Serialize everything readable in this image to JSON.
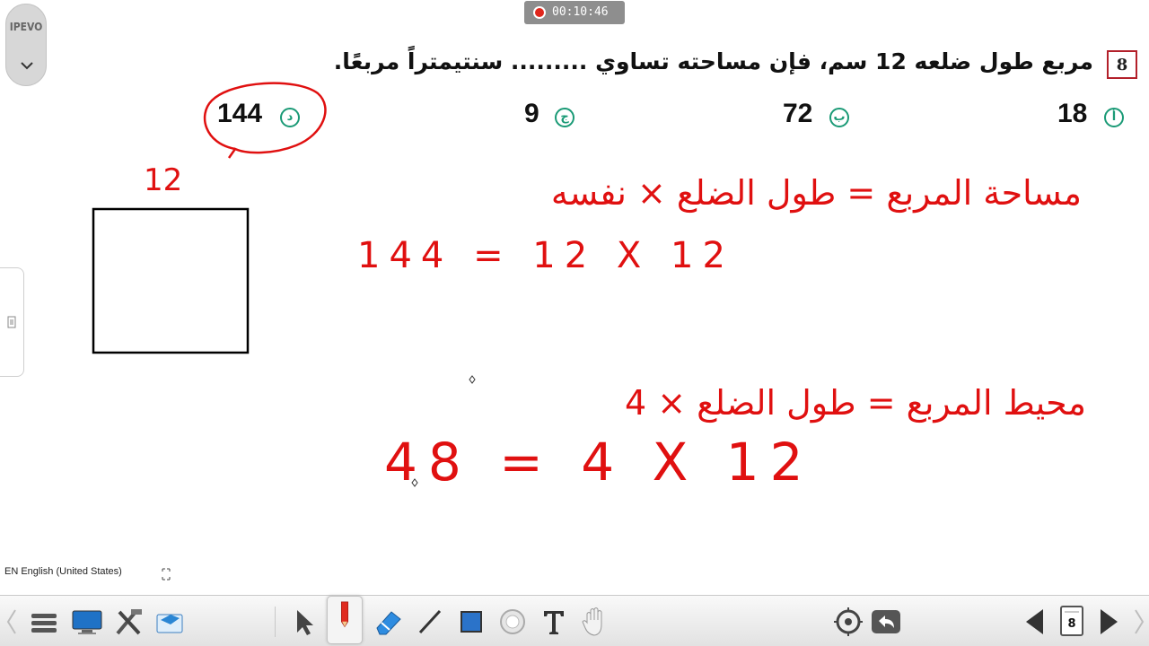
{
  "ipevo": {
    "logo": "IPEVO"
  },
  "recording": {
    "time": "00:10:46"
  },
  "question": {
    "number": "8",
    "text": "مربع طول ضلعه 12 سم، فإن مساحته تساوي ......... سنتيمتراً مربعًا.",
    "options": [
      {
        "letter": "أ",
        "value": "18"
      },
      {
        "letter": "ب",
        "value": "72"
      },
      {
        "letter": "ج",
        "value": "9"
      },
      {
        "letter": "د",
        "value": "144"
      }
    ]
  },
  "handwriting": {
    "side_label": "12",
    "area_formula": "مساحة المربع = طول الضلع × نفسه",
    "area_calc": "144 = 12 X 12",
    "perimeter_formula": "محيط المربع = طول الضلع × 4",
    "perimeter_calc": "48 = 4 X 12"
  },
  "language_bar": {
    "label": "EN English (United States)"
  },
  "toolbar": {
    "page_number": "8",
    "tools": [
      "menu-icon",
      "display-icon",
      "tools-icon",
      "capture-icon",
      "pointer-icon",
      "pen-icon",
      "eraser-icon",
      "line-icon",
      "shape-icon",
      "spotlight-icon",
      "text-icon",
      "hand-icon",
      "zoom-icon",
      "undo-icon",
      "prev-page-icon",
      "page-icon",
      "next-page-icon"
    ]
  },
  "colors": {
    "ink_red": "#e01010",
    "option_green": "#1a9a76",
    "question_border": "#b3202a"
  }
}
